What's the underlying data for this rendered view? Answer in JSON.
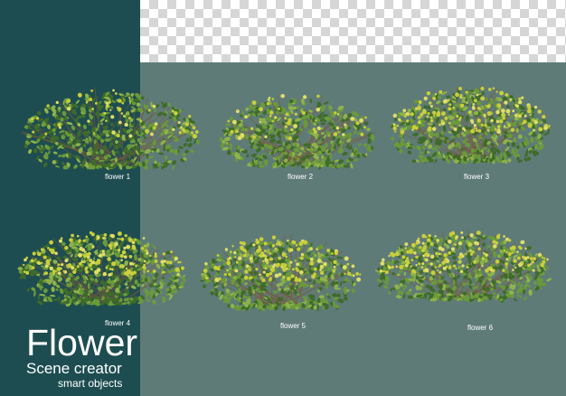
{
  "labels": [
    "flower 1",
    "flower 2",
    "flower 3",
    "flower 4",
    "flower 5",
    "flower 6"
  ],
  "brand": {
    "title": "Flower",
    "subtitle": "Scene creator",
    "tagline": "smart objects"
  },
  "colors": {
    "left_panel": "#1e4d51",
    "background": "#5f7b78",
    "leaf_dark": "#3f6b2a",
    "leaf": "#6a9a3a",
    "flower_yellow": "#c9cf3a"
  }
}
